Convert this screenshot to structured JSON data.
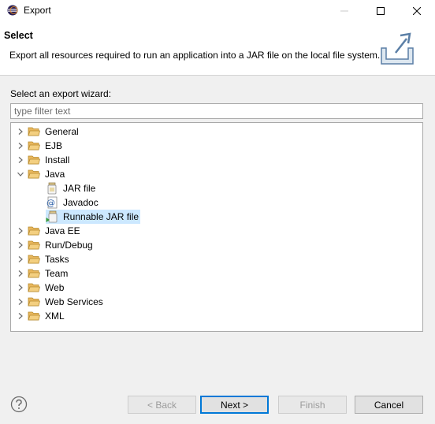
{
  "window": {
    "title": "Export"
  },
  "header": {
    "title": "Select",
    "description": "Export all resources required to run an application into a JAR file on the local file system."
  },
  "wizard": {
    "label": "Select an export wizard:",
    "filter_placeholder": "type filter text"
  },
  "tree": {
    "nodes": [
      {
        "label": "General",
        "type": "folder",
        "expanded": false
      },
      {
        "label": "EJB",
        "type": "folder",
        "expanded": false
      },
      {
        "label": "Install",
        "type": "folder",
        "expanded": false
      },
      {
        "label": "Java",
        "type": "folder",
        "expanded": true
      },
      {
        "label": "JAR file",
        "type": "jar"
      },
      {
        "label": "Javadoc",
        "type": "javadoc"
      },
      {
        "label": "Runnable JAR file",
        "type": "runnable-jar",
        "selected": true
      },
      {
        "label": "Java EE",
        "type": "folder",
        "expanded": false
      },
      {
        "label": "Run/Debug",
        "type": "folder",
        "expanded": false
      },
      {
        "label": "Tasks",
        "type": "folder",
        "expanded": false
      },
      {
        "label": "Team",
        "type": "folder",
        "expanded": false
      },
      {
        "label": "Web",
        "type": "folder",
        "expanded": false
      },
      {
        "label": "Web Services",
        "type": "folder",
        "expanded": false
      },
      {
        "label": "XML",
        "type": "folder",
        "expanded": false
      }
    ]
  },
  "buttons": {
    "back": "< Back",
    "next": "Next >",
    "finish": "Finish",
    "cancel": "Cancel"
  },
  "icons": {
    "app": "eclipse-icon",
    "help": "help-icon",
    "header": "export-wizard-icon",
    "folder": "folder-icon"
  },
  "colors": {
    "selection": "#cce8ff",
    "folder": "#e8b75d",
    "default_button_border": "#0078d7"
  }
}
